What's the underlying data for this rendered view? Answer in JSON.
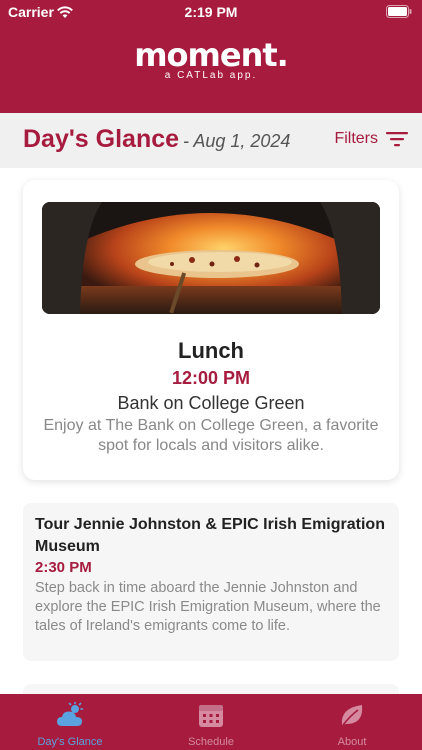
{
  "status_bar": {
    "carrier": "Carrier",
    "time": "2:19 PM"
  },
  "brand": {
    "wordmark": "moment.",
    "tagline": "a CATLab app."
  },
  "header": {
    "title": "Day's Glance",
    "date": "- Aug 1, 2024",
    "filters_label": "Filters"
  },
  "featured": {
    "title": "Lunch",
    "time": "12:00 PM",
    "place": "Bank on College Green",
    "description": "Enjoy at The Bank on College Green, a favorite spot for locals and visitors alike."
  },
  "events": [
    {
      "title": "Tour Jennie Johnston & EPIC Irish Emigration Museum",
      "time": "2:30 PM",
      "description": "Step back in time aboard the Jennie Johnston and explore the EPIC Irish Emigration Museum, where the tales of Ireland's emigrants come to life."
    }
  ],
  "tabs": [
    {
      "label": "Day's Glance",
      "icon": "weather-icon",
      "active": true
    },
    {
      "label": "Schedule",
      "icon": "calendar-icon",
      "active": false
    },
    {
      "label": "About",
      "icon": "leaf-icon",
      "active": false
    }
  ],
  "colors": {
    "brand": "#a61b3e",
    "active_tab": "#5aa3e0",
    "muted_text": "#888888"
  }
}
